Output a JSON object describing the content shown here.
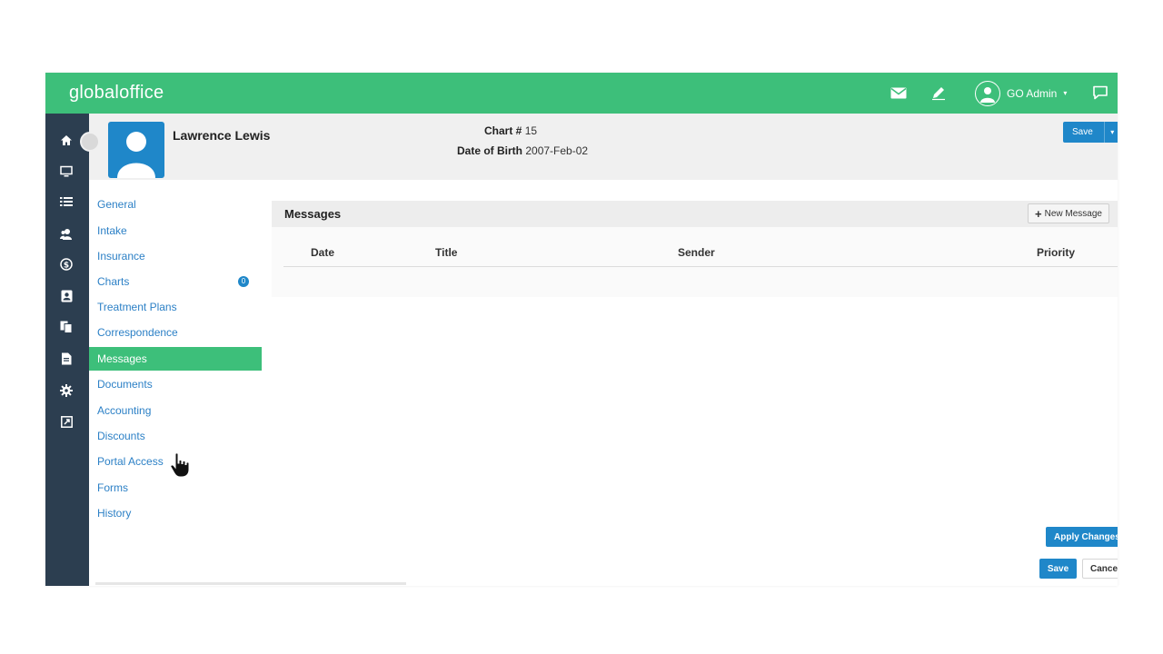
{
  "app": {
    "brand": "globaloffice"
  },
  "topbar": {
    "icons": [
      "mail-icon",
      "pencil-icon",
      "chat-icon"
    ],
    "user_name": "GO Admin",
    "user_caret": "▾"
  },
  "rail": {
    "icons": [
      "home-icon",
      "monitor-icon",
      "list-icon",
      "users-icon",
      "dollar-icon",
      "contact-card-icon",
      "copy-icon",
      "document-icon",
      "gear-icon",
      "external-link-icon"
    ]
  },
  "patient": {
    "name": "Lawrence Lewis",
    "chart_label": "Chart #",
    "chart_number": "15",
    "dob_label": "Date of Birth",
    "dob": "2007-Feb-02",
    "save_label": "Save",
    "save_caret": "▾"
  },
  "subnav": {
    "items": [
      {
        "label": "General"
      },
      {
        "label": "Intake"
      },
      {
        "label": "Insurance"
      },
      {
        "label": "Charts",
        "badge": "0"
      },
      {
        "label": "Treatment Plans"
      },
      {
        "label": "Correspondence"
      },
      {
        "label": "Messages",
        "active": true
      },
      {
        "label": "Documents"
      },
      {
        "label": "Accounting"
      },
      {
        "label": "Discounts"
      },
      {
        "label": "Portal Access"
      },
      {
        "label": "Forms"
      },
      {
        "label": "History"
      }
    ]
  },
  "messages": {
    "title": "Messages",
    "new_button": "New Message",
    "columns": [
      "Date",
      "Title",
      "Sender",
      "Priority"
    ],
    "rows": []
  },
  "actions": {
    "apply": "Apply Changes",
    "save": "Save",
    "cancel": "Cancel"
  },
  "colors": {
    "accent": "#3dbf7a",
    "primary": "#1f87c9",
    "rail": "#2c3e50",
    "link": "#2c80c6"
  }
}
